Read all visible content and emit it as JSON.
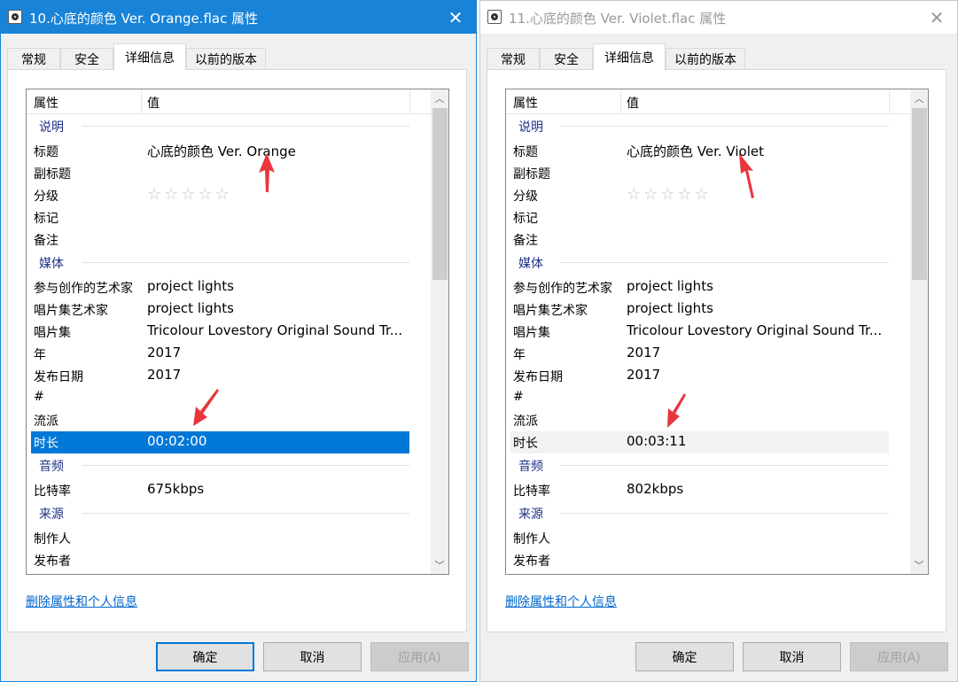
{
  "colors": {
    "accent": "#0078d7",
    "arrow": "#e8363b",
    "group": "#1e3287",
    "link": "#0066cc"
  },
  "dialogs": [
    {
      "title": "10.心底的颜色 Ver. Orange.flac 属性",
      "active": true,
      "tabs": [
        "常规",
        "安全",
        "详细信息",
        "以前的版本"
      ],
      "active_tab": "详细信息",
      "header": {
        "col_property": "属性",
        "col_value": "值"
      },
      "groups": {
        "desc": "说明",
        "media": "媒体",
        "audio": "音频",
        "origin": "来源"
      },
      "rows": {
        "title_k": "标题",
        "title_v": "心底的颜色 Ver. Orange",
        "subtitle_k": "副标题",
        "rating_k": "分级",
        "rating_stars": "☆☆☆☆☆",
        "rating_value": 0,
        "tags_k": "标记",
        "comments_k": "备注",
        "contrib_k": "参与创作的艺术家",
        "contrib_v": "project lights",
        "album_artist_k": "唱片集艺术家",
        "album_artist_v": "project lights",
        "album_k": "唱片集",
        "album_v": "Tricolour Lovestory Original Sound Tr...",
        "year_k": "年",
        "year_v": "2017",
        "release_k": "发布日期",
        "release_v": "2017",
        "track_k": "#",
        "genre_k": "流派",
        "length_k": "时长",
        "length_v": "00:02:00",
        "bitrate_k": "比特率",
        "bitrate_v": "675kbps",
        "producer_k": "制作人",
        "publisher_k": "发布者"
      },
      "remove_link": "删除属性和个人信息",
      "buttons": {
        "ok": "确定",
        "cancel": "取消",
        "apply": "应用(A)"
      }
    },
    {
      "title": "11.心底的颜色 Ver. Violet.flac 属性",
      "active": false,
      "tabs": [
        "常规",
        "安全",
        "详细信息",
        "以前的版本"
      ],
      "active_tab": "详细信息",
      "header": {
        "col_property": "属性",
        "col_value": "值"
      },
      "groups": {
        "desc": "说明",
        "media": "媒体",
        "audio": "音频",
        "origin": "来源"
      },
      "rows": {
        "title_k": "标题",
        "title_v": "心底的颜色 Ver. Violet",
        "subtitle_k": "副标题",
        "rating_k": "分级",
        "rating_stars": "☆☆☆☆☆",
        "rating_value": 0,
        "tags_k": "标记",
        "comments_k": "备注",
        "contrib_k": "参与创作的艺术家",
        "contrib_v": "project lights",
        "album_artist_k": "唱片集艺术家",
        "album_artist_v": "project lights",
        "album_k": "唱片集",
        "album_v": "Tricolour Lovestory Original Sound Tr...",
        "year_k": "年",
        "year_v": "2017",
        "release_k": "发布日期",
        "release_v": "2017",
        "track_k": "#",
        "genre_k": "流派",
        "length_k": "时长",
        "length_v": "00:03:11",
        "bitrate_k": "比特率",
        "bitrate_v": "802kbps",
        "producer_k": "制作人",
        "publisher_k": "发布者"
      },
      "remove_link": "删除属性和个人信息",
      "buttons": {
        "ok": "确定",
        "cancel": "取消",
        "apply": "应用(A)"
      }
    }
  ],
  "icons": {
    "app": "audio-file-icon",
    "close": "close-icon",
    "scroll_up": "chevron-up-icon",
    "scroll_down": "chevron-down-icon",
    "star": "star-outline-icon",
    "annotation": "red-arrow-icon"
  }
}
